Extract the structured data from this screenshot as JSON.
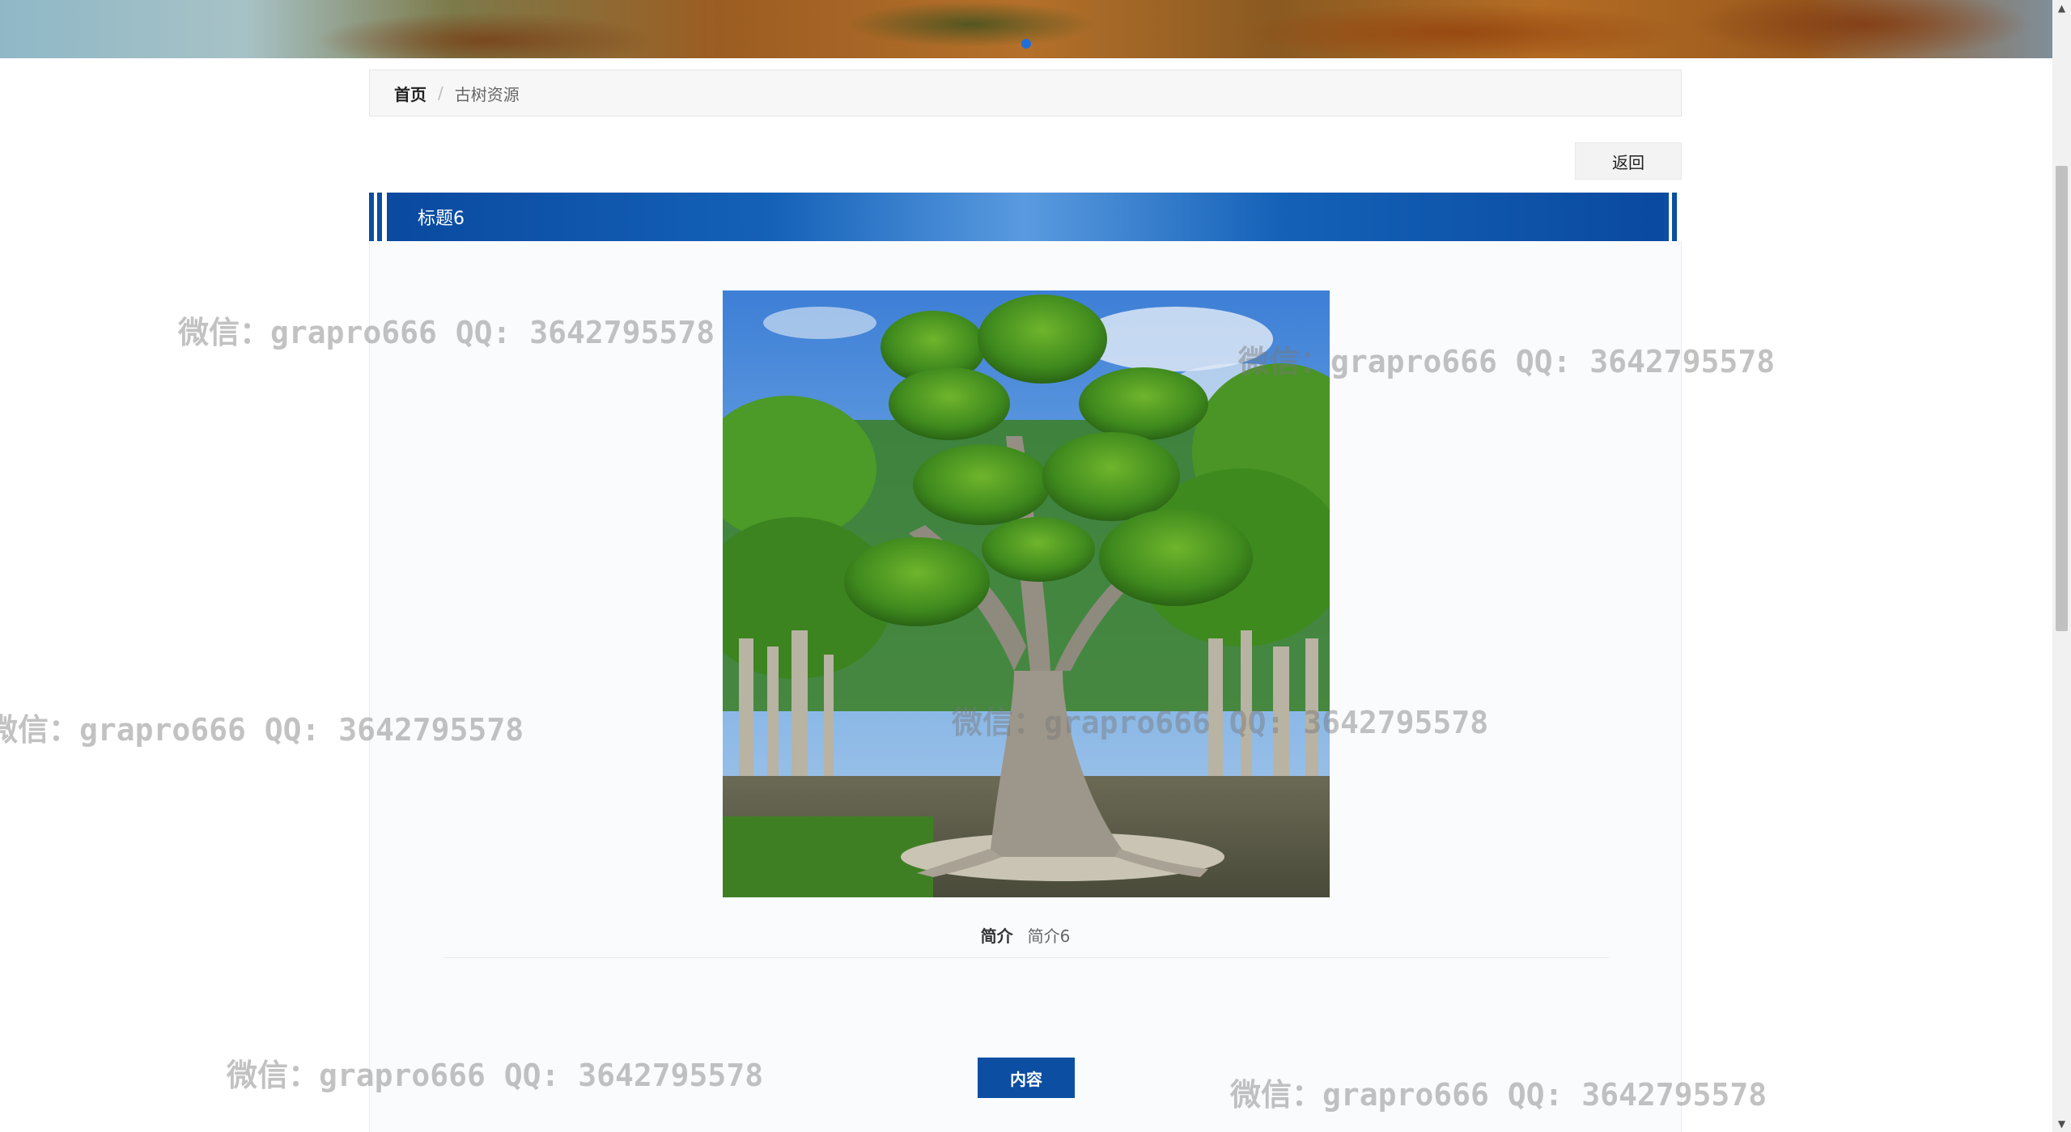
{
  "breadcrumb": {
    "home": "首页",
    "separator": "/",
    "current": "古树资源"
  },
  "back_label": "返回",
  "title": "标题6",
  "intro": {
    "label": "简介",
    "value": "简介6"
  },
  "content_label": "内容",
  "watermark_text": "微信：grapro666 QQ: 3642795578",
  "colors": {
    "primary": "#0b4ea2",
    "breadcrumb_bg": "#f7f7f7",
    "panel_bg": "#f9fbfd"
  }
}
